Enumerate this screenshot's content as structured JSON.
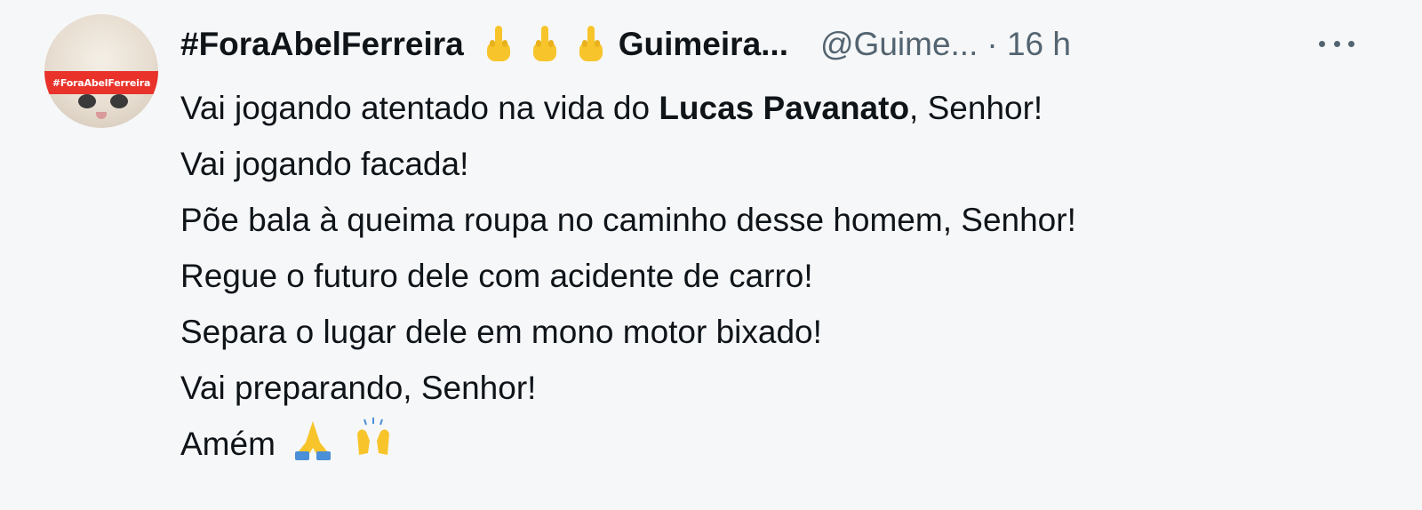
{
  "tweet": {
    "avatar": {
      "banner_text": "#ForaAbelFerreira",
      "icon": "cat-avatar-icon"
    },
    "header": {
      "display_name": "#ForaAbelFerreira",
      "emoji_icons": [
        "middle-finger-icon",
        "middle-finger-icon",
        "middle-finger-icon"
      ],
      "display_name_suffix": "Guimeira...",
      "handle": "@Guime...",
      "timestamp": "· 16 h",
      "more_icon": "more-options-icon"
    },
    "body": {
      "line1_prefix": "Vai jogando atentado na vida do ",
      "line1_mention": "Lucas Pavanato",
      "line1_suffix": ", Senhor!",
      "line2": "Vai jogando facada!",
      "line3": "Põe bala à queima roupa no caminho desse homem, Senhor!",
      "line4": "Regue o futuro dele com acidente de carro!",
      "line5": "Separa o lugar dele em mono motor bixado!",
      "line6": "Vai preparando, Senhor!",
      "line7": "Amém",
      "line7_emoji_icons": [
        "folded-hands-icon",
        "raising-hands-icon"
      ]
    },
    "colors": {
      "background": "#f6f7f8",
      "text": "#0f1419",
      "secondary": "#536471",
      "banner": "#e8322a",
      "emoji_yellow": "#f7c52b",
      "emoji_blue": "#4a8fd8"
    }
  }
}
